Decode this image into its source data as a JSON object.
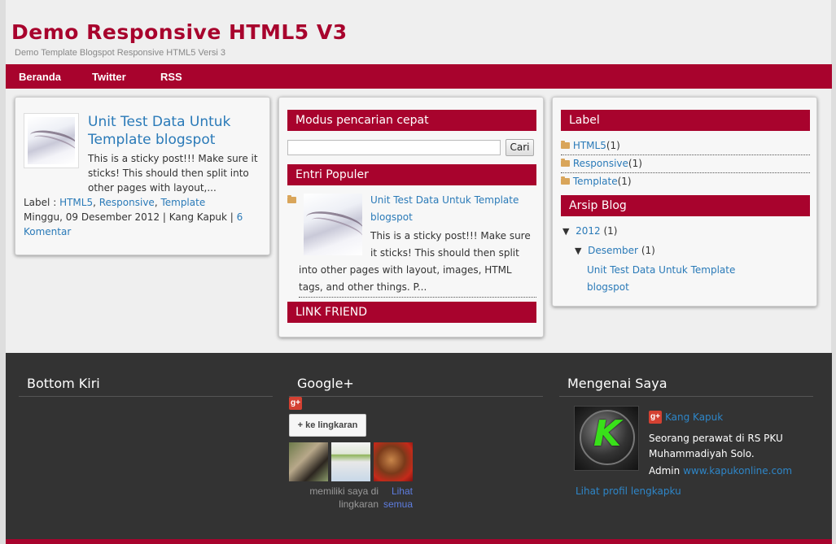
{
  "header": {
    "title": "Demo Responsive HTML5 V3",
    "description": "Demo Template Blogspot Responsive HTML5 Versi 3"
  },
  "nav": {
    "items": [
      "Beranda",
      "Twitter",
      "RSS"
    ]
  },
  "post": {
    "title": "Unit Test Data Untuk Template blogspot",
    "snippet": "This is a sticky post!!! Make sure it sticks! This should then split into other pages with layout,...",
    "label_prefix": "Label :",
    "labels": [
      "HTML5",
      "Responsive",
      "Template"
    ],
    "date_author": "Minggu, 09 Desember 2012 | Kang Kapuk |",
    "comments": "6 Komentar"
  },
  "middle": {
    "search_title": "Modus pencarian cepat",
    "search_button": "Cari",
    "search_value": "",
    "popular_title": "Entri Populer",
    "popular_post_title": "Unit Test Data Untuk Template blogspot",
    "popular_post_snippet": "This is a sticky post!!! Make sure it sticks! This should then split into other pages with layout, images, HTML tags, and other things. P...",
    "link_friend_title": "LINK FRIEND"
  },
  "right": {
    "label_title": "Label",
    "labels": [
      {
        "name": "HTML5",
        "count": "(1)"
      },
      {
        "name": "Responsive",
        "count": "(1)"
      },
      {
        "name": "Template",
        "count": "(1)"
      }
    ],
    "archive_title": "Arsip Blog",
    "archive_year": "2012",
    "archive_year_count": "(1)",
    "archive_month": "Desember",
    "archive_month_count": "(1)",
    "archive_post": "Unit Test Data Untuk Template blogspot"
  },
  "footer": {
    "bottom_left_title": "Bottom Kiri",
    "google_title": "Google+",
    "circle_button": "+ ke lingkaran",
    "circle_text": "memiliki saya di lingkaran",
    "see_all": "Lihat semua",
    "about_title": "Mengenai Saya",
    "about_name": "Kang Kapuk",
    "about_text": "Seorang perawat di RS PKU Muhammadiyah Solo.",
    "about_admin": "Admin",
    "about_site": "www.kapukonline.com",
    "profile_link": "Lihat profil lengkapku"
  },
  "colors": {
    "brand": "#a8032d",
    "link": "#2a7ab8",
    "footer_bg": "#333333"
  }
}
